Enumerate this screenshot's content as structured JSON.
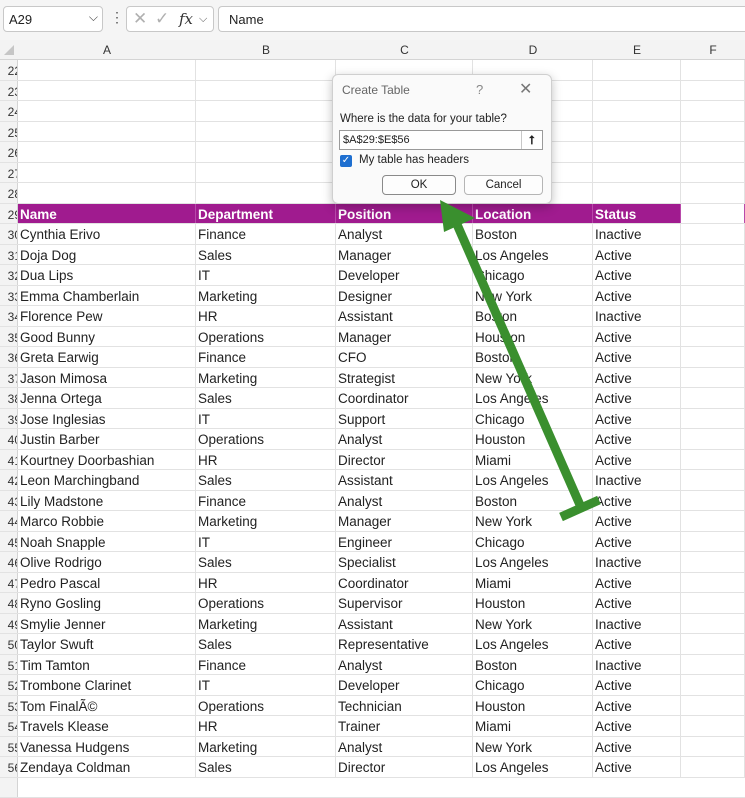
{
  "formula_bar": {
    "name_box": "A29",
    "formula_value": "Name"
  },
  "columns": [
    "A",
    "B",
    "C",
    "D",
    "E",
    "F"
  ],
  "empty_rows": [
    "22",
    "23",
    "24",
    "25",
    "26",
    "27",
    "28"
  ],
  "table": {
    "header_row": "29",
    "headers": [
      "Name",
      "Department",
      "Position",
      "Location",
      "Status"
    ],
    "rows": [
      {
        "n": "30",
        "cells": [
          "Cynthia Erivo",
          "Finance",
          "Analyst",
          "Boston",
          "Inactive"
        ]
      },
      {
        "n": "31",
        "cells": [
          "Doja Dog",
          "Sales",
          "Manager",
          "Los Angeles",
          "Active"
        ]
      },
      {
        "n": "32",
        "cells": [
          "Dua Lips",
          "IT",
          "Developer",
          "Chicago",
          "Active"
        ]
      },
      {
        "n": "33",
        "cells": [
          "Emma Chamberlain",
          "Marketing",
          "Designer",
          "New York",
          "Active"
        ]
      },
      {
        "n": "34",
        "cells": [
          "Florence Pew",
          "HR",
          "Assistant",
          "Boston",
          "Inactive"
        ]
      },
      {
        "n": "35",
        "cells": [
          "Good Bunny",
          "Operations",
          "Manager",
          "Houston",
          "Active"
        ]
      },
      {
        "n": "36",
        "cells": [
          "Greta Earwig",
          "Finance",
          "CFO",
          "Boston",
          "Active"
        ]
      },
      {
        "n": "37",
        "cells": [
          "Jason Mimosa",
          "Marketing",
          "Strategist",
          "New York",
          "Active"
        ]
      },
      {
        "n": "38",
        "cells": [
          "Jenna Ortega",
          "Sales",
          "Coordinator",
          "Los Angeles",
          "Active"
        ]
      },
      {
        "n": "39",
        "cells": [
          "Jose Inglesias",
          "IT",
          "Support",
          "Chicago",
          "Active"
        ]
      },
      {
        "n": "40",
        "cells": [
          "Justin Barber",
          "Operations",
          "Analyst",
          "Houston",
          "Active"
        ]
      },
      {
        "n": "41",
        "cells": [
          "Kourtney Doorbashian",
          "HR",
          "Director",
          "Miami",
          "Active"
        ]
      },
      {
        "n": "42",
        "cells": [
          "Leon Marchingband",
          "Sales",
          "Assistant",
          "Los Angeles",
          "Inactive"
        ]
      },
      {
        "n": "43",
        "cells": [
          "Lily Madstone",
          "Finance",
          "Analyst",
          "Boston",
          "Active"
        ]
      },
      {
        "n": "44",
        "cells": [
          "Marco Robbie",
          "Marketing",
          "Manager",
          "New York",
          "Active"
        ]
      },
      {
        "n": "45",
        "cells": [
          "Noah Snapple",
          "IT",
          "Engineer",
          "Chicago",
          "Active"
        ]
      },
      {
        "n": "46",
        "cells": [
          "Olive Rodrigo",
          "Sales",
          "Specialist",
          "Los Angeles",
          "Inactive"
        ]
      },
      {
        "n": "47",
        "cells": [
          "Pedro Pascal",
          "HR",
          "Coordinator",
          "Miami",
          "Active"
        ]
      },
      {
        "n": "48",
        "cells": [
          "Ryno Gosling",
          "Operations",
          "Supervisor",
          "Houston",
          "Active"
        ]
      },
      {
        "n": "49",
        "cells": [
          "Smylie Jenner",
          "Marketing",
          "Assistant",
          "New York",
          "Inactive"
        ]
      },
      {
        "n": "50",
        "cells": [
          "Taylor Swuft",
          "Sales",
          "Representative",
          "Los Angeles",
          "Active"
        ]
      },
      {
        "n": "51",
        "cells": [
          "Tim Tamton",
          "Finance",
          "Analyst",
          "Boston",
          "Inactive"
        ]
      },
      {
        "n": "52",
        "cells": [
          "Trombone Clarinet",
          "IT",
          "Developer",
          "Chicago",
          "Active"
        ]
      },
      {
        "n": "53",
        "cells": [
          "Tom FinalÃ©",
          "Operations",
          "Technician",
          "Houston",
          "Active"
        ]
      },
      {
        "n": "54",
        "cells": [
          "Travels Klease",
          "HR",
          "Trainer",
          "Miami",
          "Active"
        ]
      },
      {
        "n": "55",
        "cells": [
          "Vanessa Hudgens",
          "Marketing",
          "Analyst",
          "New York",
          "Active"
        ]
      },
      {
        "n": "56",
        "cells": [
          "Zendaya Coldman",
          "Sales",
          "Director",
          "Los Angeles",
          "Active"
        ]
      }
    ]
  },
  "dialog": {
    "title": "Create Table",
    "help": "?",
    "prompt": "Where is the data for your table?",
    "range_value": "$A$29:$E$56",
    "checkbox_label": "My table has headers",
    "checkbox_checked": true,
    "ok_label": "OK",
    "cancel_label": "Cancel"
  },
  "colors": {
    "header_fill": "#a01b8f",
    "arrow": "#3a8f2e",
    "checkbox": "#1e6fd0"
  }
}
